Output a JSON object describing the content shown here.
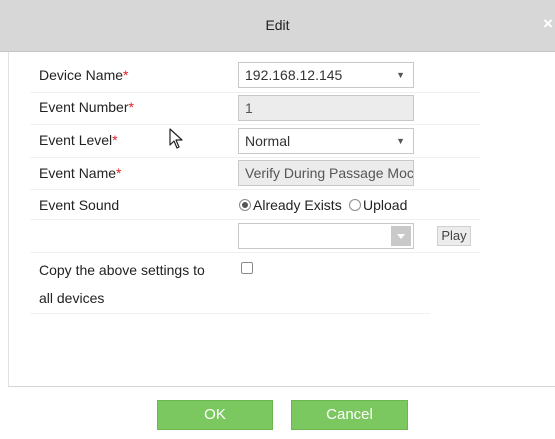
{
  "dialog": {
    "title": "Edit",
    "close_glyph": "×"
  },
  "form": {
    "device_name": {
      "label": "Device Name",
      "required_mark": "*",
      "value": "192.168.12.145"
    },
    "event_number": {
      "label": "Event Number",
      "required_mark": "*",
      "value": "1"
    },
    "event_level": {
      "label": "Event Level",
      "required_mark": "*",
      "value": "Normal"
    },
    "event_name": {
      "label": "Event Name",
      "required_mark": "*",
      "value": "Verify During Passage Moc"
    },
    "event_sound": {
      "label": "Event Sound",
      "options": [
        {
          "label": "Already Exists",
          "selected": true
        },
        {
          "label": "Upload",
          "selected": false
        }
      ],
      "sound_value": "",
      "play_label": "Play"
    },
    "copy_settings": {
      "label_line1": "Copy the above settings to",
      "label_line2": "all devices",
      "checked": false
    }
  },
  "footer": {
    "ok_label": "OK",
    "cancel_label": "Cancel"
  },
  "colors": {
    "accent_green": "#7cc860",
    "required_red": "#e02020",
    "titlebar_gray": "#d7d7d7"
  },
  "icons": {
    "dropdown": "chevron-down-icon",
    "close": "close-icon",
    "cursor": "mouse-pointer-icon"
  }
}
